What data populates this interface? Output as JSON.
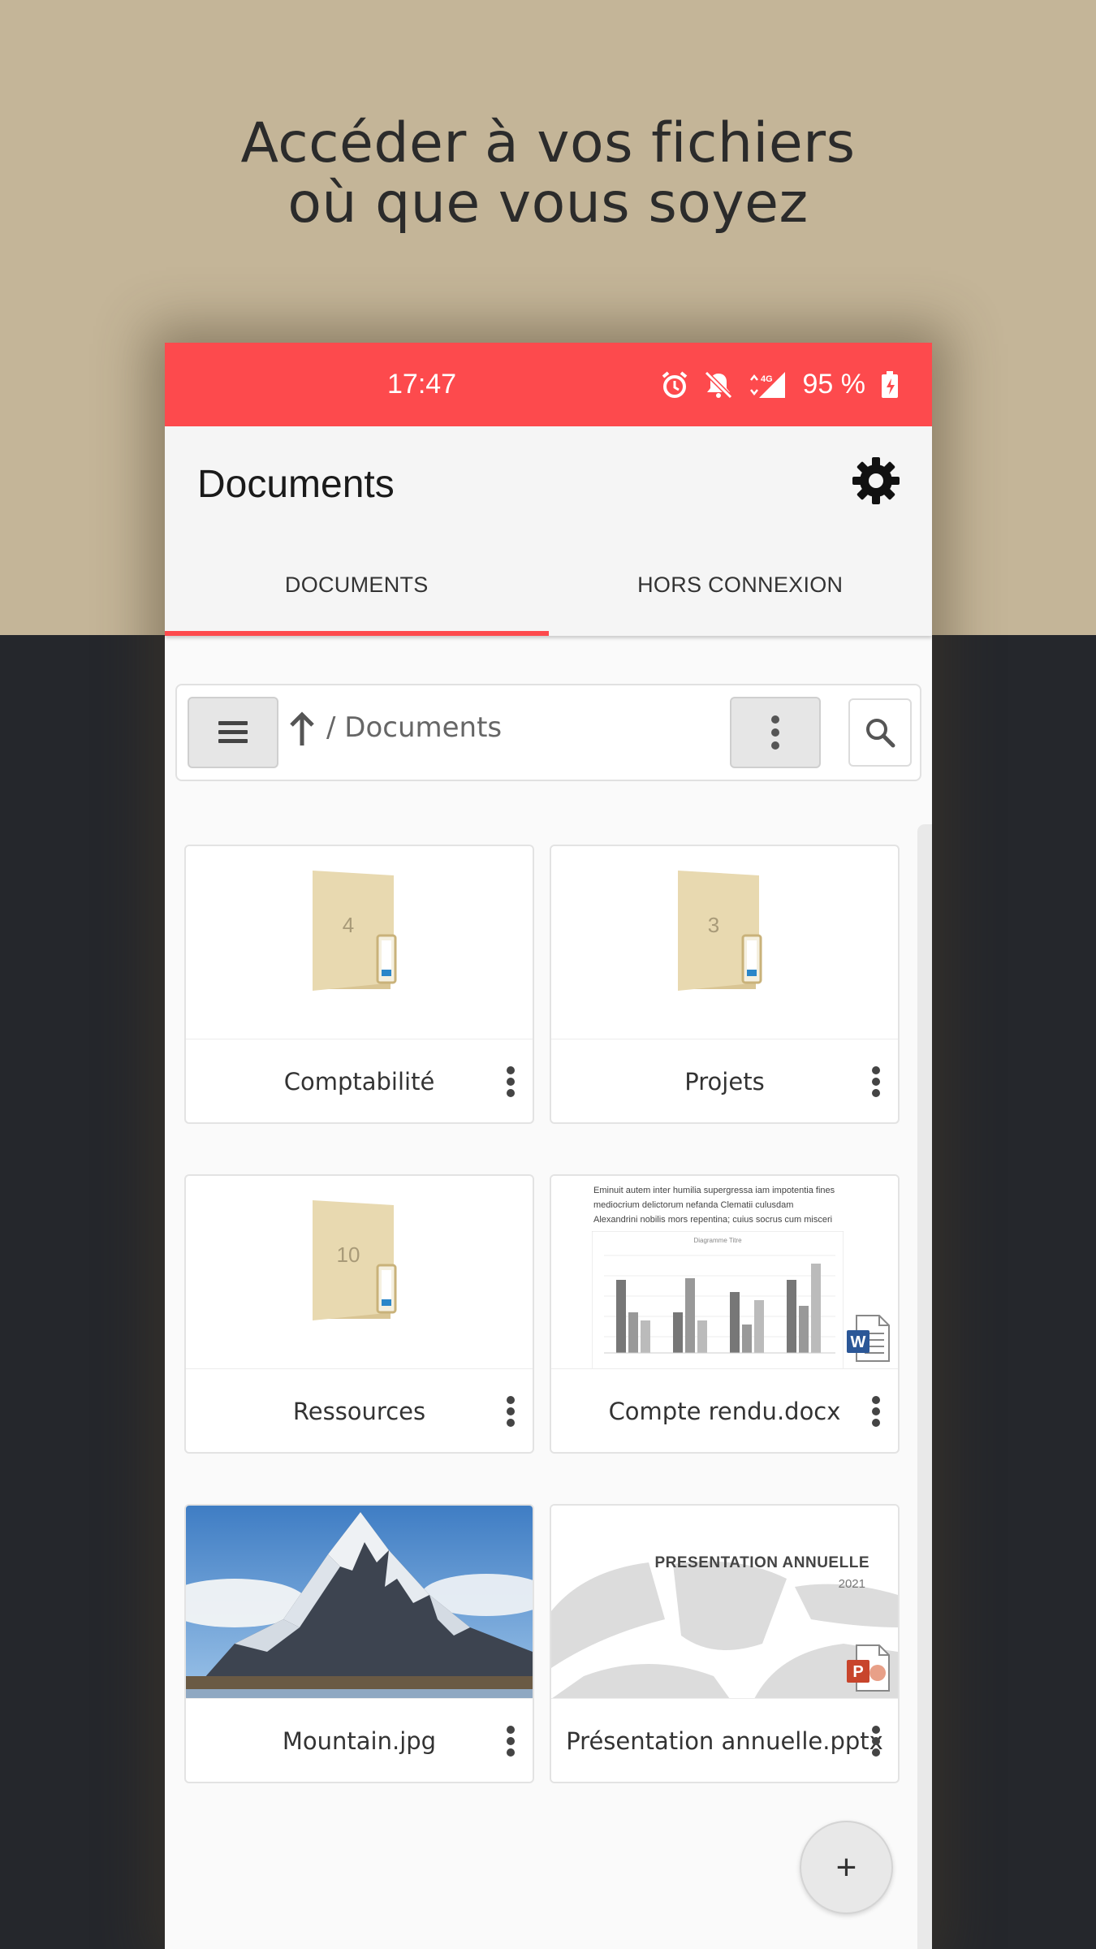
{
  "headline": {
    "line1": "Accéder à vos fichiers",
    "line2": "où que vous soyez"
  },
  "status_bar": {
    "time": "17:47",
    "battery": "95 %",
    "color": "#fd4a4d",
    "icons": [
      "alarm-icon",
      "bell-off-icon",
      "signal-4g-icon",
      "battery-charging-icon"
    ]
  },
  "app_bar": {
    "title": "Documents",
    "settings_icon": "gear-icon"
  },
  "tabs": [
    {
      "label": "DOCUMENTS",
      "active": true
    },
    {
      "label": "HORS CONNEXION",
      "active": false
    }
  ],
  "toolbar": {
    "menu_icon": "hamburger-icon",
    "up_icon": "arrow-up-icon",
    "path": "/ Documents",
    "more_icon": "kebab-icon",
    "search_icon": "search-icon"
  },
  "items": [
    {
      "name": "Comptabilité",
      "type": "folder",
      "count": "4"
    },
    {
      "name": "Projets",
      "type": "folder",
      "count": "3"
    },
    {
      "name": "Ressources",
      "type": "folder",
      "count": "10"
    },
    {
      "name": "Compte rendu.docx",
      "type": "docx",
      "preview_lines": [
        "Eminuit autem inter humilia supergressa iam impotentia fines",
        "mediocrium delictorum nefanda Clematii culusdam",
        "Alexandrini nobilis mors repentina; cuius socrus cum misceri"
      ],
      "chart_title": "Diagramme Titre"
    },
    {
      "name": "Mountain.jpg",
      "type": "image"
    },
    {
      "name": "Présentation annuelle.pptx",
      "type": "pptx",
      "preview_title": "PRESENTATION ANNUELLE",
      "preview_year": "2021"
    }
  ],
  "fab": {
    "label": "+"
  },
  "colors": {
    "accent": "#fd4a4d",
    "background_top": "#c4b598",
    "background_bottom": "#25272c",
    "folder": "#e8d9b0"
  }
}
